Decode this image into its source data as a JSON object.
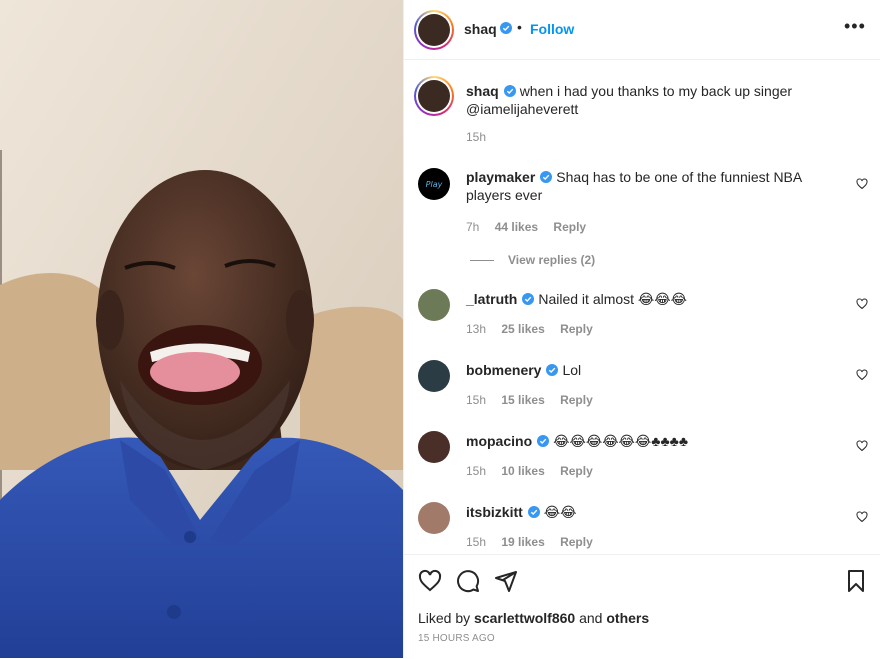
{
  "post": {
    "author": "shaq",
    "follow_label": "Follow",
    "separator": "•",
    "more_label": "•••",
    "caption": {
      "username": "shaq",
      "text": "when i had you thanks to my back up singer @iamelijaheverett",
      "time": "15h"
    }
  },
  "comments": [
    {
      "username": "playmaker",
      "verified": true,
      "text": "Shaq has to be one of the funniest NBA players ever",
      "time": "7h",
      "likes": "44 likes",
      "reply": "Reply",
      "view_replies": "View replies (2)"
    },
    {
      "username": "_latruth",
      "verified": true,
      "text": "Nailed it almost 😂😂😂",
      "time": "13h",
      "likes": "25 likes",
      "reply": "Reply"
    },
    {
      "username": "bobmenery",
      "verified": true,
      "text": "Lol",
      "time": "15h",
      "likes": "15 likes",
      "reply": "Reply"
    },
    {
      "username": "mopacino",
      "verified": true,
      "text": "😂😂😂😂😂😂♣♣♣♣",
      "time": "15h",
      "likes": "10 likes",
      "reply": "Reply"
    },
    {
      "username": "itsbizkitt",
      "verified": true,
      "text": "😂😂",
      "time": "15h",
      "likes": "19 likes",
      "reply": "Reply"
    }
  ],
  "actions": {
    "icons": [
      "heart-icon",
      "comment-icon",
      "share-icon",
      "bookmark-icon"
    ],
    "liked_by_prefix": "Liked by",
    "liked_by_user": "scarlettwolf860",
    "liked_by_and": "and",
    "liked_by_others": "others",
    "time_ago": "15 HOURS AGO"
  },
  "colors": {
    "accent": "#0095f6",
    "verified": "#3897f0",
    "text": "#262626",
    "muted": "#8e8e8e"
  }
}
